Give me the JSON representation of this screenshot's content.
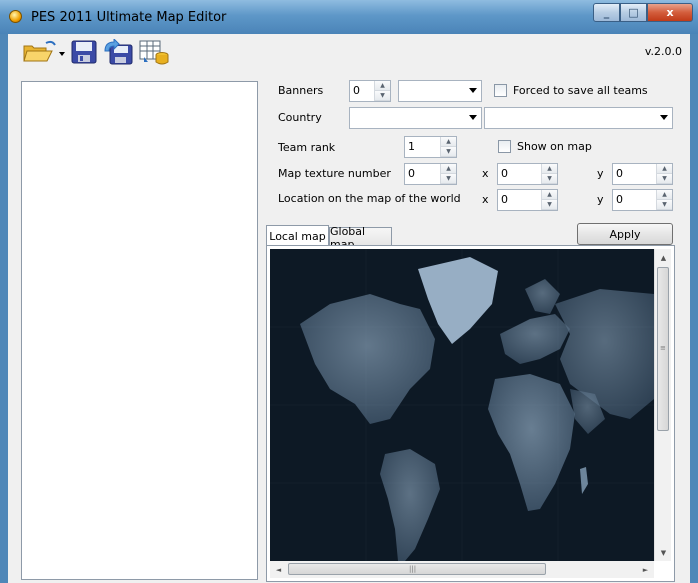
{
  "window": {
    "title": "PES 2011 Ultimate Map Editor",
    "minimize_label": "_",
    "maximize_label": "□",
    "close_label": "x"
  },
  "toolbar": {
    "version": "v.2.0.0",
    "buttons": [
      "open-folder-icon",
      "save-icon",
      "save-as-icon",
      "database-table-icon"
    ]
  },
  "form": {
    "banners": {
      "label": "Banners",
      "value": "0",
      "combo_value": ""
    },
    "forced_save": {
      "label": "Forced to save all teams",
      "checked": false
    },
    "country": {
      "label": "Country",
      "combo1_value": "",
      "combo2_value": ""
    },
    "team_rank": {
      "label": "Team rank",
      "value": "1"
    },
    "show_on_map": {
      "label": "Show on map",
      "checked": false
    },
    "map_texture": {
      "label": "Map texture number",
      "value": "0",
      "x_label": "x",
      "x_value": "0",
      "y_label": "y",
      "y_value": "0"
    },
    "location": {
      "label": "Location on the map of the world",
      "x_label": "x",
      "x_value": "0",
      "y_label": "y",
      "y_value": "0"
    }
  },
  "tabs": [
    {
      "label": "Local map",
      "active": true
    },
    {
      "label": "Global map",
      "active": false
    }
  ],
  "apply_label": "Apply",
  "colors": {
    "titlebar": "#5e97c8",
    "client_bg": "#f0f0f0",
    "map_bg": "#0e1a26"
  }
}
